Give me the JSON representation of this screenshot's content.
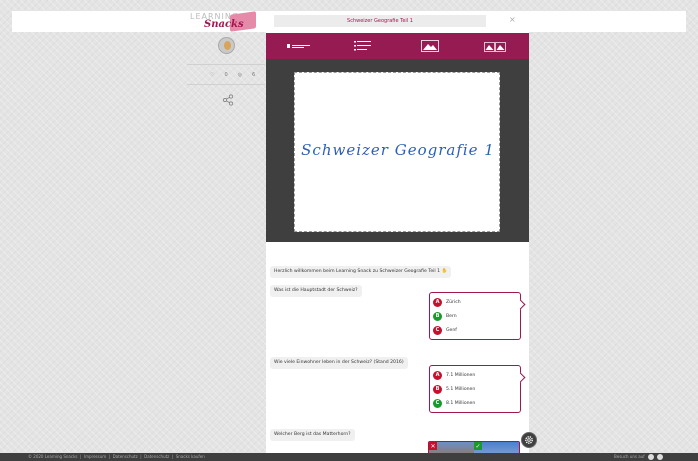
{
  "logo": {
    "line1": "LEARNING",
    "line2": "Snacks"
  },
  "profile": {
    "likes": "0",
    "views": "6"
  },
  "modal": {
    "title": "Schweizer Geografie Teil 1",
    "close": "×",
    "card_title": "Schweizer Geografie 1"
  },
  "chat": {
    "greeting": "Herzlich willkommen beim Learning Snack zu Schweizer Geografie Teil 1",
    "q1": "Was ist die Hauptstadt der Schweiz?",
    "q1_options": [
      {
        "letter": "A",
        "text": "Zürich",
        "color": "#c8102e"
      },
      {
        "letter": "B",
        "text": "Bern",
        "color": "#1a9a2a"
      },
      {
        "letter": "C",
        "text": "Genf",
        "color": "#c8102e"
      }
    ],
    "q2": "Wie viele Einwohner leben in der Schweiz? (Stand 2016)",
    "q2_options": [
      {
        "letter": "A",
        "text": "7.1 Millionen",
        "color": "#c8102e"
      },
      {
        "letter": "B",
        "text": "5.1 Millionen",
        "color": "#c8102e"
      },
      {
        "letter": "C",
        "text": "8.1 Millionen",
        "color": "#1a9a2a"
      }
    ],
    "q3": "Welcher Berg ist das Matterhorn?"
  },
  "footer": {
    "copyright": "© 2020 Learning Snacks",
    "links": [
      "Impressum",
      "Datenschutz",
      "Datenschutz",
      "Snacks kaufen"
    ],
    "right": "Besuch uns auf"
  },
  "colors": {
    "brand": "#951b52",
    "dark": "#3f3f3f"
  }
}
